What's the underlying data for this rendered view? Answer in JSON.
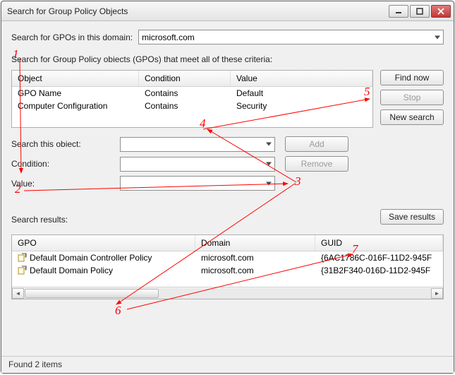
{
  "title": "Search for Group Policy Objects",
  "domain_label": "Search for GPOs in this domain:",
  "domain_value": "microsoft.com",
  "criteria_label": "Search for Group Policy obiects (GPOs) that meet all of these criteria:",
  "criteria_columns": {
    "object": "Object",
    "condition": "Condition",
    "value": "Value"
  },
  "criteria_rows": [
    {
      "object": "GPO Name",
      "condition": "Contains",
      "value": "Default"
    },
    {
      "object": "Computer Configuration",
      "condition": "Contains",
      "value": "Security"
    }
  ],
  "buttons": {
    "find_now": "Find now",
    "stop": "Stop",
    "new_search": "New search",
    "add": "Add",
    "remove": "Remove",
    "save_results": "Save results"
  },
  "form": {
    "search_object_label": "Search this obiect:",
    "condition_label": "Condition:",
    "value_label": "Value:",
    "search_object_value": "",
    "condition_value": "",
    "value_value": ""
  },
  "results_label": "Search results:",
  "results_columns": {
    "gpo": "GPO",
    "domain": "Domain",
    "guid": "GUID"
  },
  "results_rows": [
    {
      "gpo": "Default Domain Controller Policy",
      "domain": "microsoft.com",
      "guid": "{6AC1786C-016F-11D2-945F"
    },
    {
      "gpo": "Default Domain Policy",
      "domain": "microsoft.com",
      "guid": "{31B2F340-016D-11D2-945F"
    }
  ],
  "status": "Found 2 items",
  "annotations": [
    "1",
    "2",
    "3",
    "4",
    "5",
    "6",
    "7"
  ]
}
